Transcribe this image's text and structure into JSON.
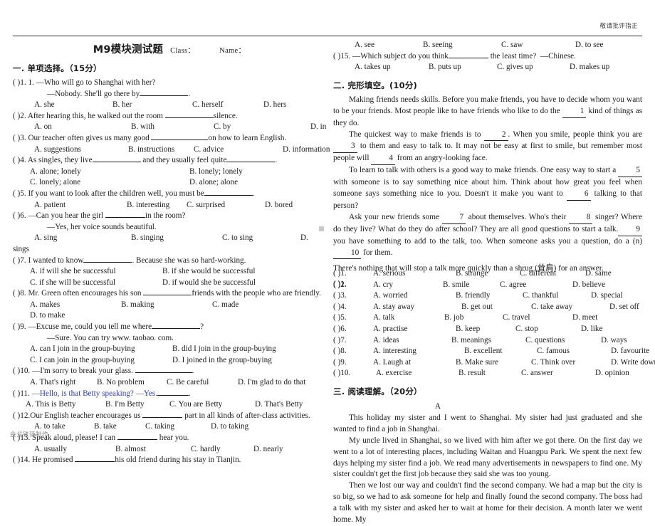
{
  "header": {
    "note": "敬请批评指正"
  },
  "watermark": "金戈铁骑制作",
  "title": {
    "main": "M9模块测试题",
    "class_label": "Class：",
    "name_label": "Name："
  },
  "sections": {
    "one": "一. 单项选择。（15分）",
    "two": "二. 完形填空。(10分)",
    "three": "三. 阅读理解。（20分）",
    "passage_a_letter": "A"
  },
  "multiple_choice": [
    {
      "marker": "(  )1.",
      "stem": "1. —Who will go to Shanghai with her?",
      "stem2": "—Nobody. She'll go there by",
      "stem2_tail": ".",
      "options": [
        "A. she",
        "B. her",
        "C. herself",
        "D. hers"
      ]
    },
    {
      "marker": "(  )2.",
      "stem_pre": "After hearing this, he walked out the room",
      "stem_post": "silence.",
      "options": [
        "A. on",
        "B. with",
        "C. by",
        "D. in"
      ]
    },
    {
      "marker": "(  )3.",
      "stem_pre": "Our teacher often gives us many good",
      "stem_post": "on how to learn English.",
      "options": [
        "A. suggestions",
        "B. instructions",
        "C. advice",
        "D. information"
      ]
    },
    {
      "marker": "(  )4.",
      "stem_pre": "As singles, they live",
      "stem_mid": "and they usually feel quite",
      "stem_post": ".",
      "options": [
        "A. alone; lonely",
        "B. lonely; lonely",
        "C. lonely; alone",
        "D. alone; alone"
      ]
    },
    {
      "marker": "(  )5.",
      "stem_pre": "If you want to look after the children well, you must be",
      "stem_post": ".",
      "options": [
        "A. patient",
        "B. interesting",
        "C. surprised",
        "D. bored"
      ]
    },
    {
      "marker": "(  )6.",
      "stem_pre": "—Can you hear the girl",
      "stem_post": "in the room?",
      "stem2": "—Yes, her voice sounds beautiful.",
      "options": [
        "A. sing",
        "B. singing",
        "C. to sing",
        "D.",
        "sings"
      ]
    },
    {
      "marker": "(  )7.",
      "stem_pre": "I wanted to know",
      "stem_post": ". Because she was so hard-working.",
      "options": [
        "A. if will she be successful",
        "B. if she would be successful",
        "C. if she will be successful",
        "D. if would she be successful"
      ]
    },
    {
      "marker": "(  )8.",
      "stem_pre": "Mr. Green often encourages his son",
      "stem_post": "friends with the people who are friendly.",
      "options": [
        "A. makes",
        "B. making",
        "C. made",
        "D. to make"
      ]
    },
    {
      "marker": "(  )9.",
      "stem_pre": "—Excuse me, could you tell me where",
      "stem_post": "?",
      "stem2": "—Sure. You can try www. taobao. com.",
      "options": [
        "A. can I join in the group-buying",
        "B. did I join in the group-buying",
        "C. I can join in the group-buying",
        "D. I joined in the group-buying"
      ]
    },
    {
      "marker": "(  )10.",
      "stem_pre": "—I'm sorry to break your glass.",
      "stem_post": ".",
      "options": [
        "A. That's right",
        "B. No problem",
        "C. Be careful",
        "D. I'm glad to do that"
      ]
    },
    {
      "marker": "(  )11.",
      "stem_pre": "—Hello, is that Betty speaking?",
      "stem_mid": "—Yes.",
      "stem_post": ".",
      "options": [
        "A. This is Betty",
        "B. I'm Betty",
        "C. You are Betty",
        "D. That's Betty"
      ]
    },
    {
      "marker": "(  )12.",
      "stem_pre": "Our English teacher encourages us",
      "stem_post": "part in all kinds of after-class activities.",
      "options": [
        "A. to take",
        "B. take",
        "C. taking",
        "D. to taking"
      ]
    },
    {
      "marker": "(  )13.",
      "stem_pre": "Speak aloud, please! I can",
      "stem_post": "hear you.",
      "options": [
        "A. usually",
        "B. almost",
        "C. hardly",
        "D. nearly"
      ]
    },
    {
      "marker": "(  )14.",
      "stem_pre": "He promised",
      "stem_post": "his old friend during his stay in Tianjin.",
      "options": [
        "A. see",
        "B. seeing",
        "C. saw",
        "D. to see"
      ]
    },
    {
      "marker": "(  )15.",
      "stem_pre": "—Which subject do you think",
      "stem_post": "the least time?",
      "stem_tail": "—Chinese.",
      "options": [
        "A. takes up",
        "B. puts up",
        "C. gives up",
        "D. makes up"
      ]
    }
  ],
  "cloze": {
    "paragraphs": [
      {
        "parts": [
          "Making friends needs skills. Before you make friends, you have to decide whom you want to be your friends. Most people like to have friends who like to do the ",
          "1",
          " kind of things as they do."
        ]
      },
      {
        "parts": [
          "The quickest way to make friends is to ",
          "2",
          ". When you smile, people think you are ",
          "3",
          " to them and easy to talk to. It may not be easy at first to smile, but remember most people will ",
          "4",
          " from an angry-looking face."
        ]
      },
      {
        "parts": [
          "To learn to talk with others is a good way to make friends. One easy way to start a ",
          "5",
          " with someone is to say something nice about him. Think about how great you feel when someone says something nice to you. Doesn't it make you want to ",
          "6",
          " talking to that person?"
        ]
      },
      {
        "parts": [
          "Ask your new friends some ",
          "7",
          " about themselves. Who's their ",
          "8",
          " singer? Where do they live? What do they do after school? They are all good questions to start a talk.",
          "9",
          " you have something to add to the talk, too. When someone asks you a question, do a (n)",
          "10",
          " for them."
        ]
      }
    ],
    "closing": "There's nothing that will stop a talk more quickly than a shrug (耸肩) for an answer.",
    "questions": [
      {
        "marker": "(  )1.",
        "options": [
          "A. serious",
          "B. strange",
          "C. different",
          "D. same"
        ]
      },
      {
        "marker": "(  )2.",
        "options": [
          "A. cry",
          "B. smile",
          "C. agree",
          "D. believe"
        ]
      },
      {
        "marker": "(  )3.",
        "options": [
          "A. worried",
          "B. friendly",
          "C. thankful",
          "D. special"
        ]
      },
      {
        "marker": "(  )4.",
        "options": [
          "A. stay away",
          "B. get out",
          "C. take away",
          "D. set off"
        ]
      },
      {
        "marker": "(  )5.",
        "options": [
          "A. talk",
          "B. job",
          "C. travel",
          "D. meet"
        ]
      },
      {
        "marker": "(  )6.",
        "options": [
          "A. practise",
          "B. keep",
          "C. stop",
          "D. like"
        ]
      },
      {
        "marker": "(  )7.",
        "options": [
          "A. ideas",
          "B. meanings",
          "C. questions",
          "D. ways"
        ]
      },
      {
        "marker": "(  )8.",
        "options": [
          "A. interesting",
          "B. excellent",
          "C. famous",
          "D. favourite"
        ]
      },
      {
        "marker": "(  )9.",
        "options": [
          "A. Laugh at",
          "B. Make sure",
          "C. Think over",
          "D. Write down"
        ]
      },
      {
        "marker": "(  )10.",
        "options": [
          "A. exercise",
          "B. result",
          "C. answer",
          "D. opinion"
        ]
      }
    ]
  },
  "reading": {
    "paragraphs": [
      "This holiday my sister and I went to Shanghai. My sister had just graduated and she wanted to find a job in Shanghai.",
      "My uncle lived in Shanghai, so we lived with him after we got there. On the first day we went to a lot of interesting places, including Waitan and Huangpu Park. We spent the next few days helping my sister find a job. We read many advertisements in newspapers to find one. My sister couldn't get the first job because they said she was too young.",
      "Then we lost our way and couldn't find the second company. We had a map but the city is so big, so we had to ask someone for help and finally found the second company. The boss had a talk with my sister and asked her to wait at home for their decision. A month later we went home. My"
    ]
  }
}
